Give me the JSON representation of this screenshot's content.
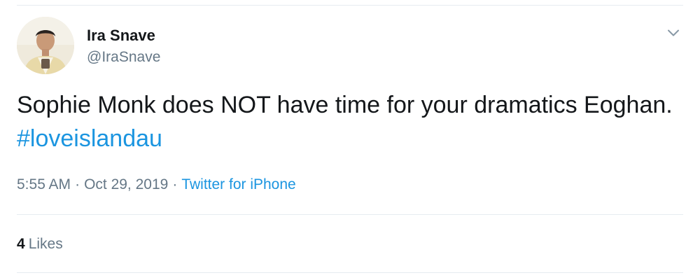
{
  "tweet": {
    "author": {
      "name": "Ira Snave",
      "handle": "@IraSnave",
      "avatar_icon": "user-avatar-photo"
    },
    "menu_icon": "chevron-down-icon",
    "text_main": "Sophie Monk does NOT have time for your dramatics Eoghan.",
    "hashtag": "#loveislandau",
    "time": "5:55 AM",
    "separator": "·",
    "date": "Oct 29, 2019",
    "source": "Twitter for iPhone",
    "likes_count": "4",
    "likes_label": "Likes"
  },
  "colors": {
    "text": "#14171a",
    "secondary": "#657786",
    "link": "#1b95e0",
    "divider": "#e6ecf0"
  }
}
